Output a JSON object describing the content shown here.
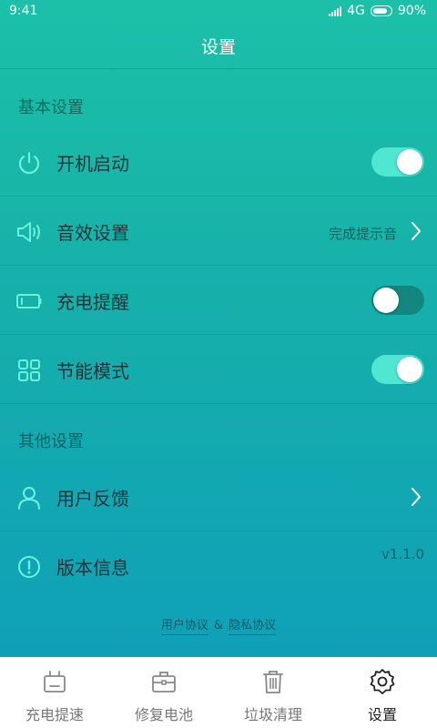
{
  "status_bar": {
    "time": "9:41",
    "network": "4G",
    "battery": "90%"
  },
  "header": {
    "title": "设置"
  },
  "sections": {
    "basic": {
      "title": "基本设置"
    },
    "other": {
      "title": "其他设置"
    }
  },
  "rows": {
    "startup": {
      "label": "开机启动",
      "toggle": true,
      "icon": "power-icon"
    },
    "sound": {
      "label": "音效设置",
      "value": "完成提示音",
      "icon": "speaker-icon"
    },
    "charge_reminder": {
      "label": "充电提醒",
      "toggle": false,
      "icon": "battery-icon"
    },
    "power_saving": {
      "label": "节能模式",
      "toggle": true,
      "icon": "grid-icon"
    },
    "feedback": {
      "label": "用户反馈",
      "icon": "user-icon"
    },
    "version": {
      "label": "版本信息",
      "value": "v1.1.0",
      "icon": "info-icon"
    }
  },
  "footer": {
    "user_agreement": "用户协议",
    "ampersand": "&",
    "privacy_policy": "隐私协议"
  },
  "bottom_nav": {
    "items": [
      {
        "label": "充电提速",
        "icon": "charger-icon"
      },
      {
        "label": "修复电池",
        "icon": "toolbox-icon"
      },
      {
        "label": "垃圾清理",
        "icon": "trash-icon"
      },
      {
        "label": "设置",
        "icon": "gear-icon",
        "active": true
      }
    ]
  },
  "colors": {
    "accent": "#4fe6d2",
    "toggle_off": "#13877f",
    "background_top": "#1cc0a8",
    "background_bottom": "#0fa0b8"
  }
}
